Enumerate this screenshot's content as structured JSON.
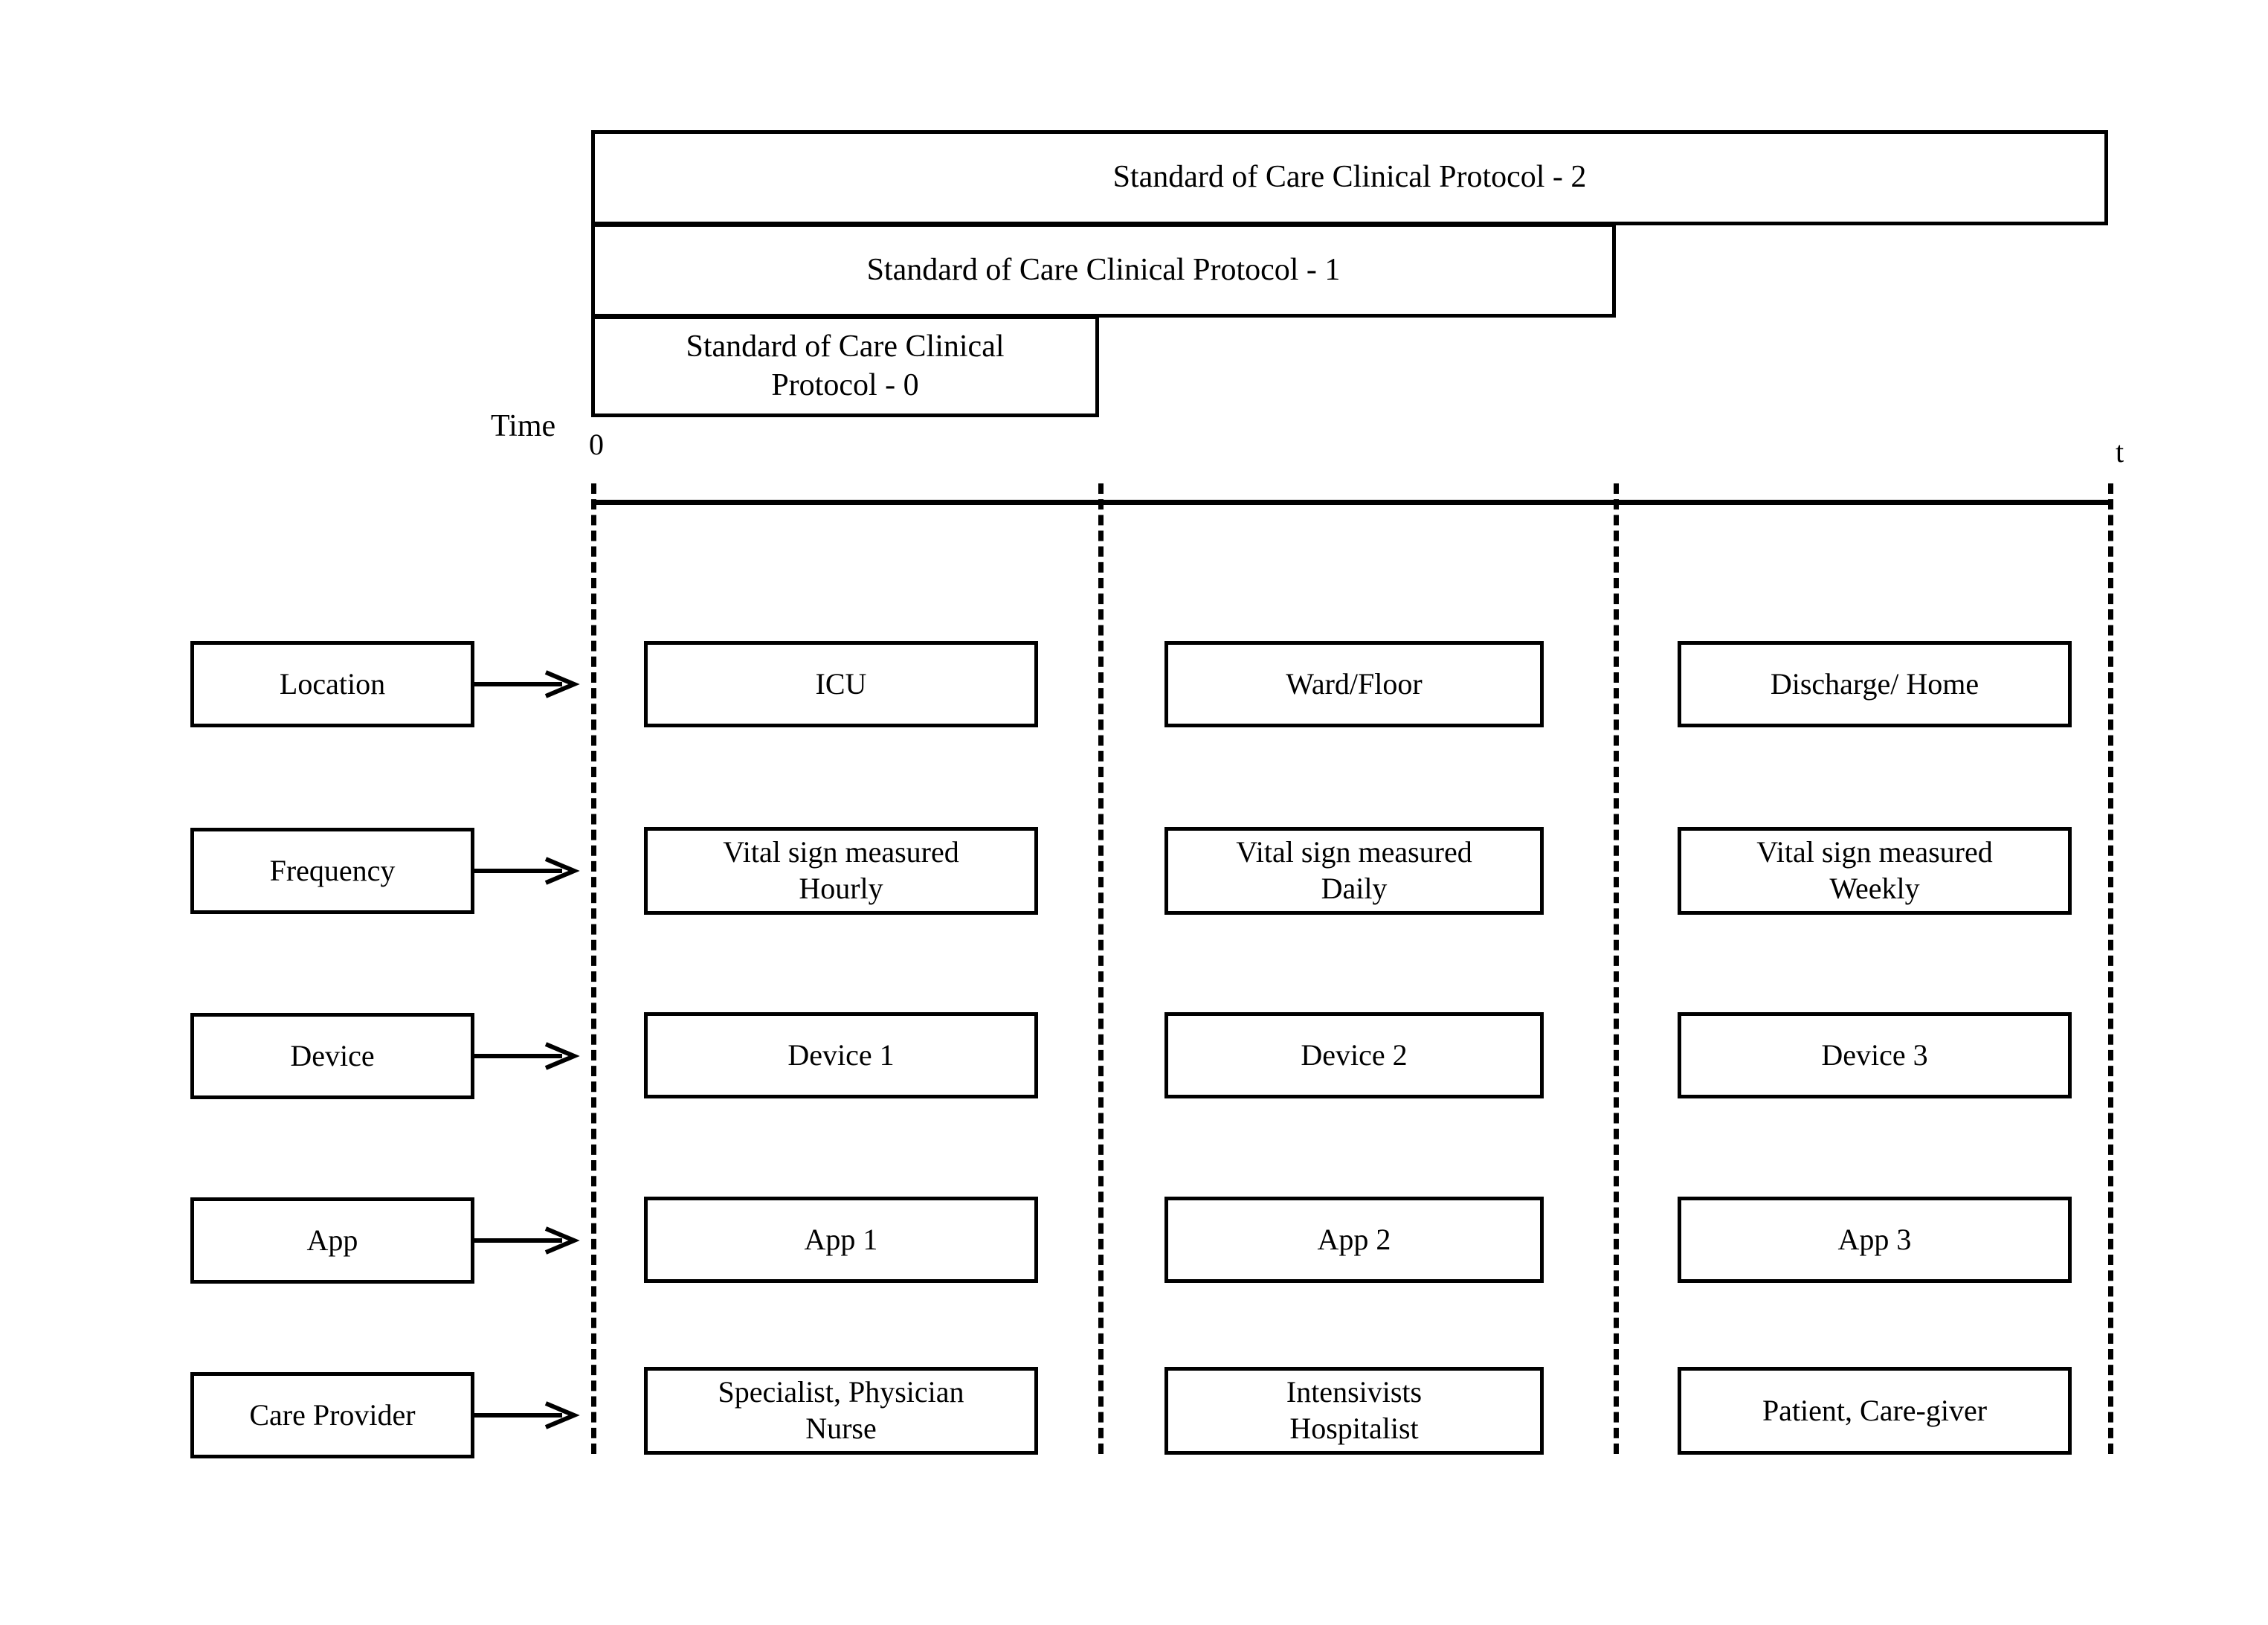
{
  "diagram": {
    "protocols": [
      {
        "id": "protocol-2",
        "label": "Standard of Care Clinical Protocol - 2"
      },
      {
        "id": "protocol-1",
        "label": "Standard of Care Clinical Protocol - 1"
      },
      {
        "id": "protocol-0",
        "label": "Standard of Care Clinical\nProtocol - 0"
      }
    ],
    "axis": {
      "name": "Time",
      "start_tick": "0",
      "end_tick": "t"
    },
    "row_labels": [
      {
        "key": "location",
        "label": "Location"
      },
      {
        "key": "frequency",
        "label": "Frequency"
      },
      {
        "key": "device",
        "label": "Device"
      },
      {
        "key": "app",
        "label": "App"
      },
      {
        "key": "care_provider",
        "label": "Care Provider"
      }
    ],
    "phases": [
      {
        "index": 1,
        "location": "ICU",
        "frequency": "Vital sign measured\nHourly",
        "device": "Device 1",
        "app": "App 1",
        "care_provider": "Specialist, Physician\nNurse"
      },
      {
        "index": 2,
        "location": "Ward/Floor",
        "frequency": "Vital sign measured\nDaily",
        "device": "Device 2",
        "app": "App 2",
        "care_provider": "Intensivists\nHospitalist"
      },
      {
        "index": 3,
        "location": "Discharge/ Home",
        "frequency": "Vital sign measured\nWeekly",
        "device": "Device 3",
        "app": "App 3",
        "care_provider": "Patient, Care-giver"
      }
    ],
    "colors": {
      "stroke": "#000000",
      "background": "#ffffff"
    }
  }
}
